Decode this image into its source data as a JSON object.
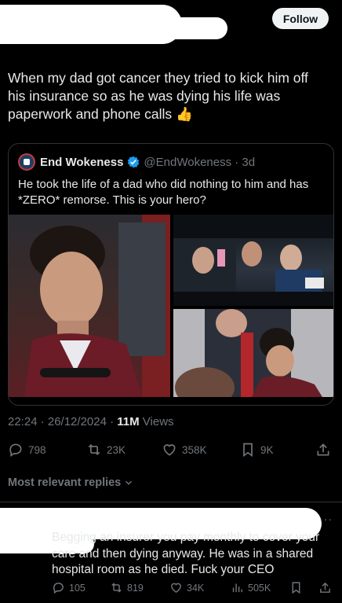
{
  "header": {
    "follow_label": "Follow"
  },
  "tweet": {
    "text": "When my dad got cancer they tried to kick him off his insurance so as he was dying his life was paperwork and phone calls",
    "emoji": "👍"
  },
  "quote": {
    "name": "End Wokeness",
    "handle": "@EndWokeness · 3d",
    "text": "He took the life of a dad who did nothing to him and has *ZERO* remorse. This is your hero?"
  },
  "meta": {
    "time": "22:24 · 26/12/2024 · ",
    "views_count": "11M",
    "views_label": " Views"
  },
  "actions": {
    "replies": "798",
    "reposts": "23K",
    "likes": "358K",
    "bookmarks": "9K"
  },
  "replies_filter": {
    "label": "Most relevant replies"
  },
  "reply": {
    "more": "···",
    "text": "Begging an insurer you pay monthly to cover your care and then dying anyway. He was in a shared hospital room as he died. Fuck your CEO",
    "replies": "105",
    "reposts": "819",
    "likes": "34K",
    "views": "505K"
  },
  "colors": {
    "background": "#000000",
    "text": "#e7e9ea",
    "muted": "#71767b",
    "verified": "#1d9bf0"
  }
}
